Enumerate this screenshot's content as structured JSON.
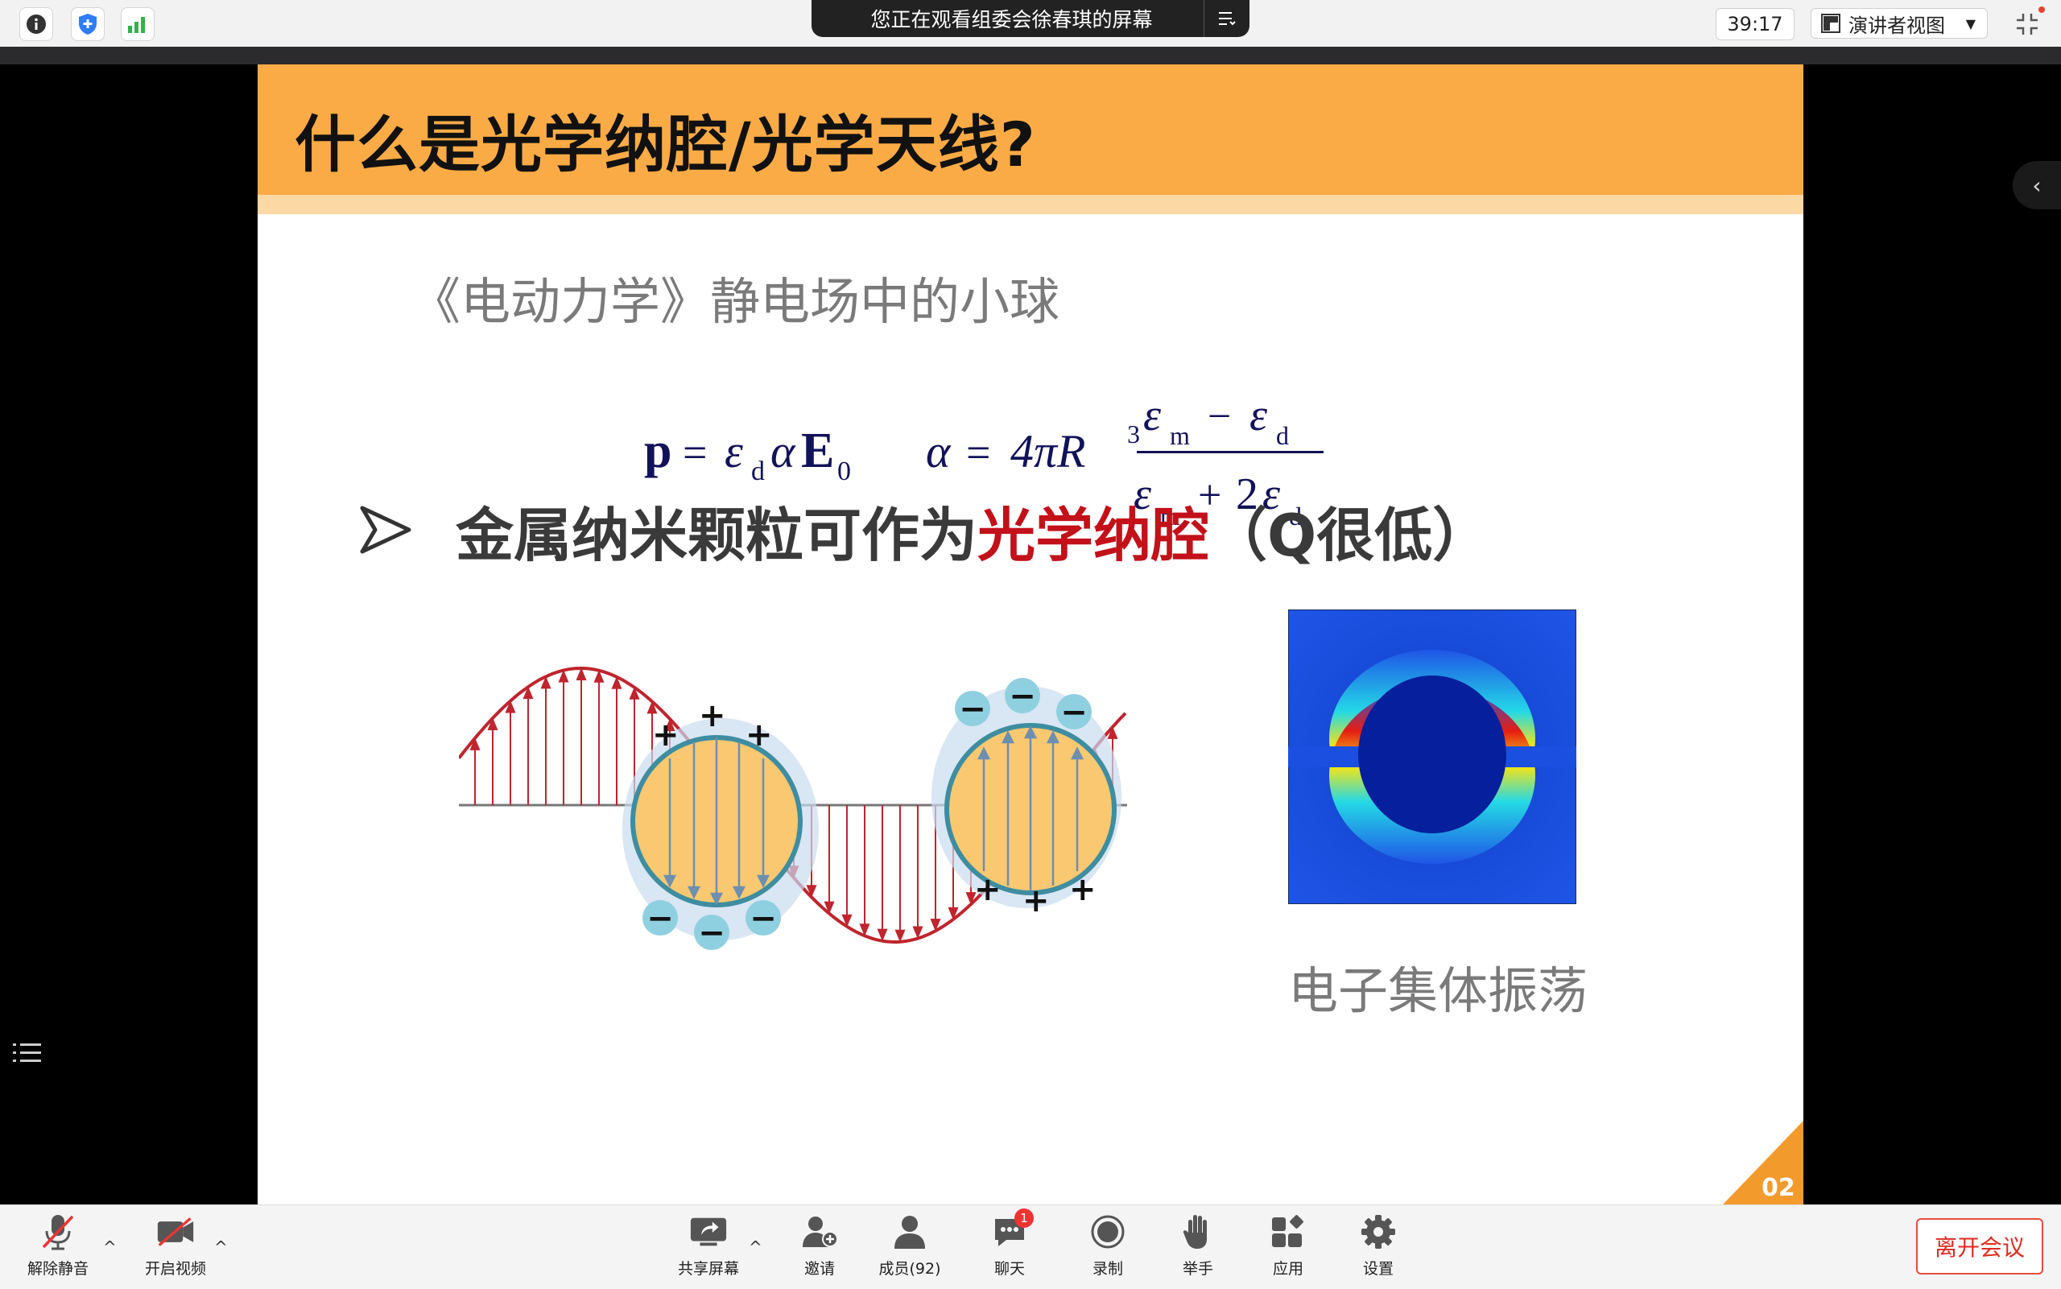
{
  "topbar": {
    "icons": [
      "info-icon",
      "shield-icon",
      "signal-icon"
    ],
    "viewing_text": "您正在观看组委会徐春琪的屏幕",
    "timer": "39:17",
    "view_mode": "演讲者视图"
  },
  "slide": {
    "title": "什么是光学纳腔/光学天线?",
    "subheading": "《电动力学》静电场中的小球",
    "formula": {
      "p": "p",
      "eq": "=",
      "eps": "ε",
      "d": "d",
      "alpha": "α",
      "E": "E",
      "zero": "0",
      "four_pi_R": "4πR",
      "three": "3",
      "m": "m",
      "minus": "−",
      "plus": "+",
      "two": "2"
    },
    "bullet_text": "金属纳米颗粒可作为",
    "bullet_highlight": "光学纳腔",
    "bullet_suffix": "（Q很低）",
    "diagram_signs": {
      "plus": "+",
      "minus": "−"
    },
    "caption": "电子集体振荡",
    "page_number": "02",
    "colors": {
      "header": "#fbab45",
      "header_band": "#fcd8a4",
      "highlight": "#c3111a",
      "wave": "#c0242d",
      "sphere_fill": "#f9c871",
      "sphere_edge": "#3e8da0"
    }
  },
  "toolbar": {
    "left": [
      {
        "label": "解除静音",
        "icon": "mic-muted-icon"
      },
      {
        "label": "开启视频",
        "icon": "camera-off-icon"
      }
    ],
    "center": [
      {
        "label": "共享屏幕",
        "icon": "share-screen-icon"
      },
      {
        "label": "邀请",
        "icon": "invite-icon"
      },
      {
        "label": "成员(92)",
        "icon": "members-icon"
      },
      {
        "label": "聊天",
        "icon": "chat-icon",
        "badge": "1"
      },
      {
        "label": "录制",
        "icon": "record-icon"
      },
      {
        "label": "举手",
        "icon": "raise-hand-icon"
      },
      {
        "label": "应用",
        "icon": "apps-icon"
      },
      {
        "label": "设置",
        "icon": "settings-icon"
      }
    ],
    "leave": "离开会议"
  }
}
